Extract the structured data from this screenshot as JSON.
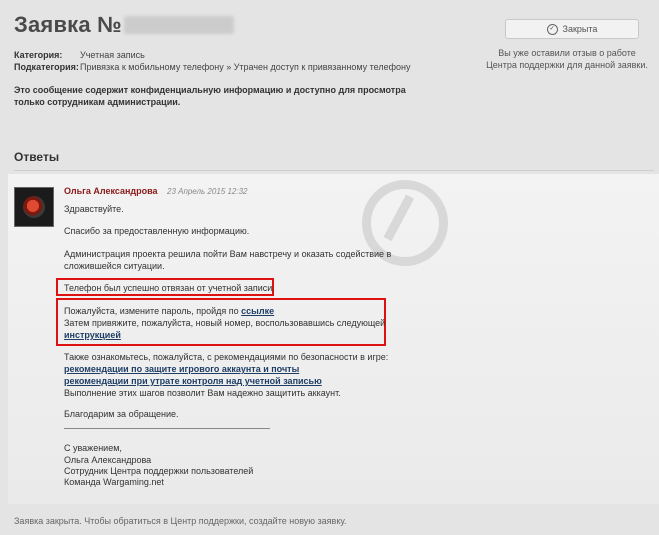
{
  "ticket": {
    "title_prefix": "Заявка №",
    "category_label": "Категория:",
    "category_value": "Учетная запись",
    "subcategory_label": "Подкатегория:",
    "subcategory_value": "Привязка к мобильному телефону » Утрачен доступ к привязанному телефону",
    "notice": "Это сообщение содержит конфиденциальную информацию и доступно для просмотра только сотрудникам администрации."
  },
  "status": {
    "icon": "check-circle-icon",
    "label": "Закрыта",
    "feedback_line1": "Вы уже оставили отзыв о работе",
    "feedback_line2": "Центра поддержки для данной заявки."
  },
  "answers": {
    "title": "Ответы",
    "author": "Ольга Александрова",
    "date": "23 Апрель 2015 12:32",
    "greeting": "Здравствуйте.",
    "thanks_info": "Спасибо за предоставленную информацию.",
    "admin_line1": "Администрация проекта решила пойти Вам навстречу и оказать содействие в",
    "admin_line2": "сложившейся ситуации.",
    "unlinked": "Телефон был успешно отвязан от учетной записи.",
    "password_prefix": "Пожалуйста, измените пароль, пройдя по",
    "password_link": "ссылке",
    "relink_text": "Затем привяжите, пожалуйста, новый номер, воспользовавшись следующей",
    "instructions_link": "инструкцией",
    "security_intro": "Также ознакомьтесь, пожалуйста, с рекомендациями по безопасности в игре:",
    "security_link1": "рекомендации по защите игрового аккаунта и почты",
    "security_link2": "рекомендации при утрате контроля над учетной записью",
    "security_outro": "Выполнение этих шагов позволит Вам надежно защитить аккаунт.",
    "thanks_closing": "Благодарим за обращение.",
    "sign_regards": "С уважением,",
    "sign_name": "Ольга Александрова",
    "sign_role": "Сотрудник Центра поддержки пользователей",
    "sign_company": "Команда Wargaming.net"
  },
  "footer": {
    "text": "Заявка закрыта. Чтобы обратиться в Центр поддержки, создайте новую заявку."
  },
  "colors": {
    "author": "#8b1a1a",
    "link": "#1f3e66",
    "highlight": "#dd1111"
  }
}
